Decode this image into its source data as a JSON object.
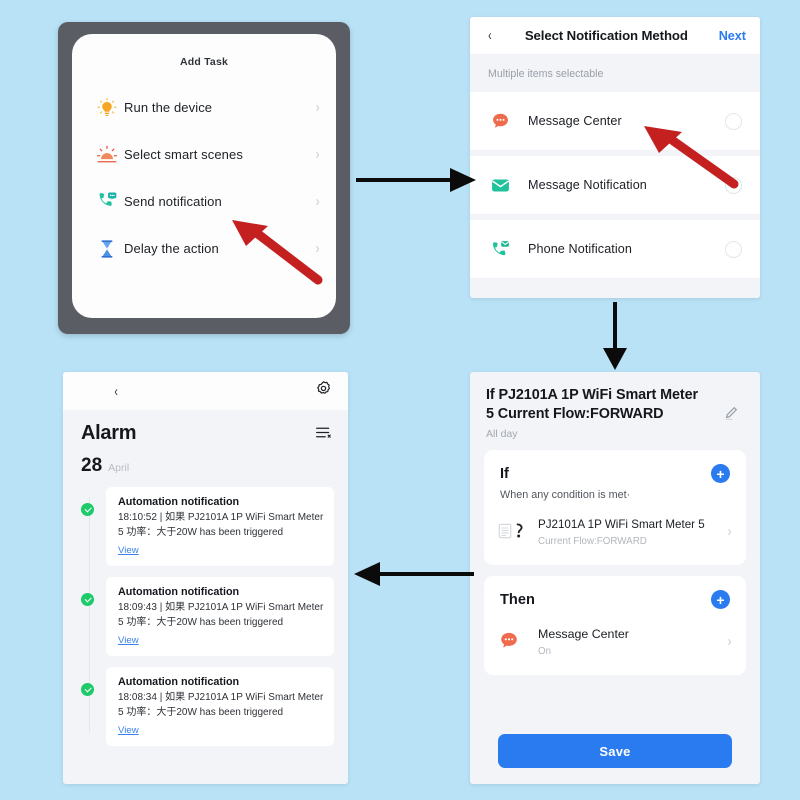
{
  "theme": {
    "background": "#b9e2f7",
    "accent_blue": "#2a7bf0",
    "link_blue": "#3d82e8",
    "green_dot": "#1ecb6b",
    "phone_frame": "#5a5d63",
    "panel_bg": "#f3f4f8",
    "arrow_red": "#c42020"
  },
  "add_task_panel": {
    "title": "Add Task",
    "items": [
      {
        "label": "Run the device",
        "icon": "bulb-icon",
        "chevron": "›"
      },
      {
        "label": "Select smart scenes",
        "icon": "sunrise-icon",
        "chevron": "›"
      },
      {
        "label": "Send notification",
        "icon": "phone-message-icon",
        "chevron": "›"
      },
      {
        "label": "Delay the action",
        "icon": "hourglass-icon",
        "chevron": "›"
      }
    ]
  },
  "notification_method_panel": {
    "back_icon": "‹",
    "title": "Select Notification Method",
    "next_label": "Next",
    "hint": "Multiple items selectable",
    "items": [
      {
        "label": "Message Center",
        "icon": "chat-bubble-icon",
        "selected": false
      },
      {
        "label": "Message Notification",
        "icon": "envelope-icon",
        "selected": false
      },
      {
        "label": "Phone Notification",
        "icon": "phone-mail-icon",
        "selected": false
      }
    ]
  },
  "automation_panel": {
    "title": "If PJ2101A 1P WiFi Smart Meter  5 Current Flow:FORWARD",
    "subtitle": "All day",
    "edit_icon": "pencil-icon",
    "if_card": {
      "heading": "If",
      "add_icon": "+",
      "condition_text": "When any condition is met·",
      "device_name": "PJ2101A 1P WiFi Smart Meter 5",
      "device_meta": "Current Flow:FORWARD",
      "device_icon": "meter-icon",
      "chevron": "›"
    },
    "then_card": {
      "heading": "Then",
      "add_icon": "+",
      "action_name": "Message Center",
      "action_state": "On",
      "action_icon": "chat-bubble-icon",
      "chevron": "›"
    },
    "save_label": "Save"
  },
  "alarm_panel": {
    "back_icon": "‹",
    "gear_icon": "gear-icon",
    "title": "Alarm",
    "filter_icon": "filter-list-icon",
    "date_day": "28",
    "date_month": "April",
    "notifications": [
      {
        "title": "Automation notification",
        "body": "18:10:52 | 如果 PJ2101A 1P WiFi Smart Meter  5 功率：大于20W has been triggered",
        "link": "View",
        "status": "success"
      },
      {
        "title": "Automation notification",
        "body": "18:09:43 | 如果 PJ2101A 1P WiFi Smart Meter  5 功率：大于20W has been triggered",
        "link": "View",
        "status": "success"
      },
      {
        "title": "Automation notification",
        "body": "18:08:34 | 如果 PJ2101A 1P WiFi Smart Meter  5 功率：大于20W has been triggered",
        "link": "View",
        "status": "success"
      }
    ]
  },
  "flow_arrows": [
    {
      "name": "arrow-addtask-to-method",
      "direction": "right"
    },
    {
      "name": "arrow-method-to-automation",
      "direction": "down"
    },
    {
      "name": "arrow-automation-to-alarm",
      "direction": "left"
    }
  ],
  "callout_arrows": [
    {
      "name": "callout-send-notification",
      "target": "Send notification"
    },
    {
      "name": "callout-message-center",
      "target": "Message Center"
    }
  ]
}
